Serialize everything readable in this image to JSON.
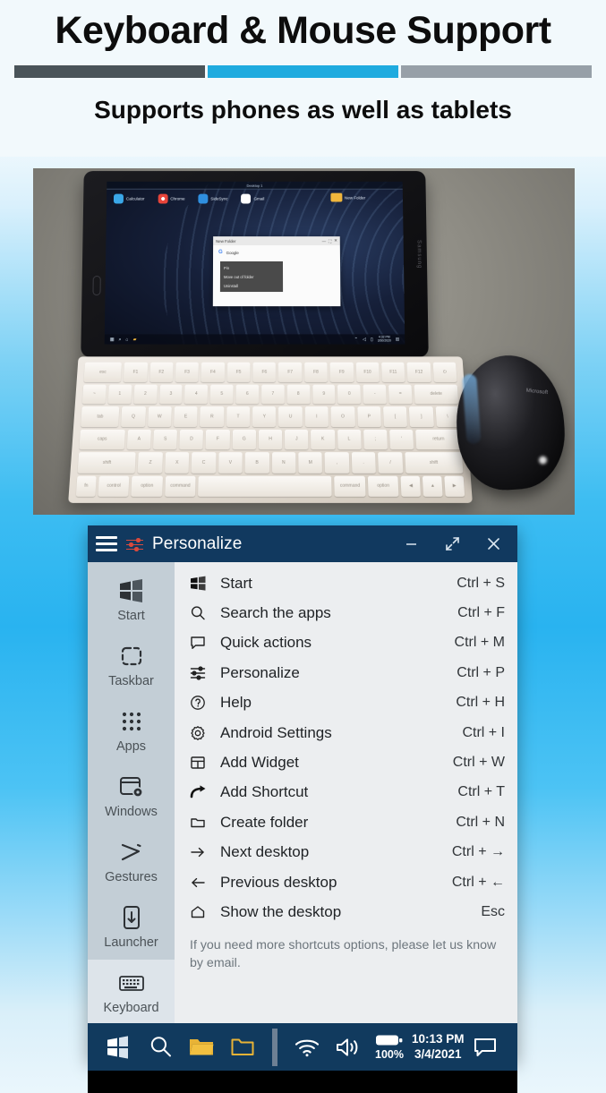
{
  "header": {
    "title": "Keyboard & Mouse Support",
    "subtitle": "Supports phones as well as tablets",
    "rule_colors": [
      "#4a5459",
      "#1fabdf",
      "#97a0a8"
    ]
  },
  "photo": {
    "alt_name": "tablet-keyboard-mouse-photo",
    "tablet_brand": "Samsung",
    "mouse_brand": "Microsoft",
    "tablet_screen": {
      "desktop_label": "Desktop 1",
      "desktop_icons": [
        {
          "label": "Calculator",
          "color": "#3aa7e8"
        },
        {
          "label": "Chrome",
          "color": "#e8443a"
        },
        {
          "label": "SideSync",
          "color": "#2f8fe0"
        },
        {
          "label": "Gmail",
          "color": "#ffffff"
        }
      ],
      "folder_label": "New Folder",
      "window": {
        "title": "New Folder",
        "item": "Google",
        "context_menu": [
          "Pin",
          "Move out of folder",
          "Uninstall"
        ],
        "buttons": [
          "minimize",
          "maximize",
          "close"
        ]
      },
      "status_time": "4:32 PM",
      "status_date": "3/30/2020"
    }
  },
  "window": {
    "titlebar": {
      "title": "Personalize",
      "menu_icon": "hamburger-icon",
      "app_icon": "sliders-icon",
      "accent": "#d94a3d",
      "background": "#11395f",
      "minimize_label": "Minimize",
      "maximize_label": "Maximize",
      "close_label": "Close"
    },
    "sidebar": {
      "items": [
        {
          "label": "Start",
          "icon": "windows-logo-icon",
          "active": false
        },
        {
          "label": "Taskbar",
          "icon": "dashed-square-icon",
          "active": false
        },
        {
          "label": "Apps",
          "icon": "grid-dots-icon",
          "active": false
        },
        {
          "label": "Windows",
          "icon": "window-gear-icon",
          "active": false
        },
        {
          "label": "Gestures",
          "icon": "gesture-icon",
          "active": false
        },
        {
          "label": "Launcher",
          "icon": "launcher-icon",
          "active": false
        },
        {
          "label": "Keyboard",
          "icon": "keyboard-icon",
          "active": true
        }
      ]
    },
    "menu": {
      "items": [
        {
          "label": "Start",
          "shortcut": "Ctrl + S",
          "icon": "windows-logo-icon"
        },
        {
          "label": "Search the apps",
          "shortcut": "Ctrl + F",
          "icon": "search-icon"
        },
        {
          "label": "Quick actions",
          "shortcut": "Ctrl + M",
          "icon": "speech-bubble-icon"
        },
        {
          "label": "Personalize",
          "shortcut": "Ctrl + P",
          "icon": "sliders-icon"
        },
        {
          "label": "Help",
          "shortcut": "Ctrl + H",
          "icon": "question-circle-icon"
        },
        {
          "label": "Android Settings",
          "shortcut": "Ctrl + I",
          "icon": "gear-icon"
        },
        {
          "label": "Add Widget",
          "shortcut": "Ctrl + W",
          "icon": "widget-icon"
        },
        {
          "label": "Add Shortcut",
          "shortcut": "Ctrl + T",
          "icon": "arrow-curve-right-icon"
        },
        {
          "label": "Create folder",
          "shortcut": "Ctrl + N",
          "icon": "folder-icon"
        },
        {
          "label": "Next desktop",
          "shortcut": "Ctrl + →",
          "icon": "arrow-right-icon"
        },
        {
          "label": "Previous desktop",
          "shortcut": "Ctrl + ←",
          "icon": "arrow-left-icon"
        },
        {
          "label": "Show the desktop",
          "shortcut": "Esc",
          "icon": "home-icon"
        }
      ],
      "note": "If you need more shortcuts options, please let us know by email."
    }
  },
  "taskbar": {
    "background": "#113a5e",
    "items": [
      {
        "name": "start-button",
        "icon": "windows-logo-icon"
      },
      {
        "name": "search-button",
        "icon": "search-icon"
      },
      {
        "name": "file-explorer-button",
        "icon": "folder-filled-icon"
      },
      {
        "name": "folder-button",
        "icon": "folder-outline-icon"
      }
    ],
    "tray": [
      {
        "name": "wifi-status",
        "icon": "wifi-icon"
      },
      {
        "name": "volume-status",
        "icon": "speaker-icon"
      }
    ],
    "battery": {
      "icon": "battery-icon",
      "percent": "100%"
    },
    "clock": {
      "time": "10:13 PM",
      "date": "3/4/2021"
    },
    "notifications": {
      "icon": "speech-bubble-icon"
    }
  }
}
